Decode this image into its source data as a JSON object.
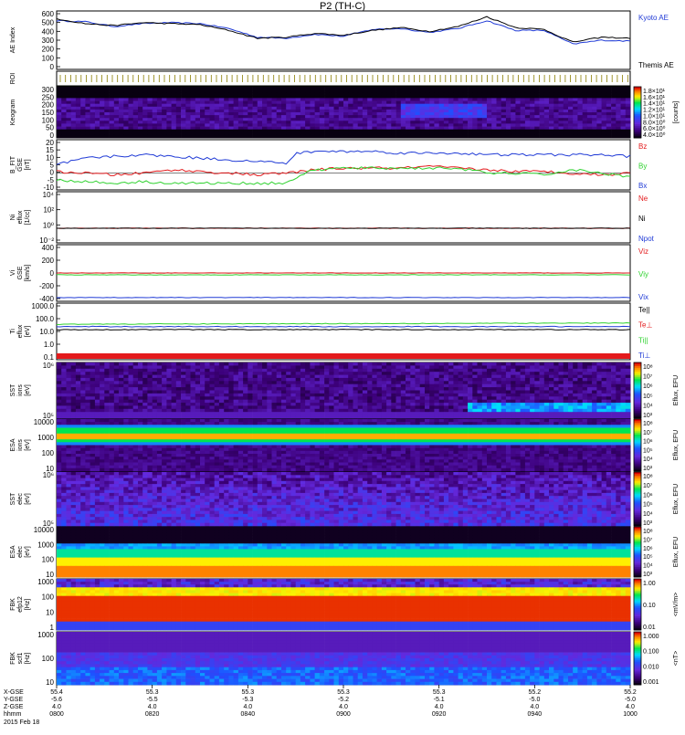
{
  "title": "P2 (TH-C)",
  "date_label": "2015 Feb 18",
  "colors": {
    "blue": "#1f3ad6",
    "red": "#e31a1c",
    "green": "#2fd22f",
    "black": "#000000"
  },
  "chart_data": [
    {
      "id": "ae",
      "type": "line",
      "ylabel": [
        "AE Index"
      ],
      "y_ticks": [
        "600",
        "500",
        "400",
        "300",
        "200",
        "100",
        "0"
      ],
      "ylim": [
        0,
        600
      ],
      "legend": [
        {
          "name": "Kyoto AE",
          "color": "#1f3ad6"
        },
        {
          "name": "Themis AE",
          "color": "#000000"
        }
      ],
      "series": [
        {
          "name": "Kyoto AE",
          "color": "#1f3ad6",
          "x": [
            0,
            0.05,
            0.1,
            0.15,
            0.2,
            0.25,
            0.3,
            0.35,
            0.4,
            0.45,
            0.5,
            0.55,
            0.6,
            0.65,
            0.7,
            0.75,
            0.8,
            0.85,
            0.9,
            0.95,
            1.0
          ],
          "values": [
            500,
            490,
            440,
            470,
            480,
            470,
            420,
            330,
            320,
            360,
            340,
            410,
            420,
            380,
            420,
            500,
            400,
            400,
            260,
            300,
            290
          ]
        },
        {
          "name": "Themis AE",
          "color": "#000000",
          "x": [
            0,
            0.05,
            0.1,
            0.15,
            0.2,
            0.25,
            0.3,
            0.35,
            0.4,
            0.45,
            0.5,
            0.55,
            0.6,
            0.65,
            0.7,
            0.75,
            0.8,
            0.85,
            0.9,
            0.95,
            1.0
          ],
          "values": [
            520,
            470,
            450,
            480,
            470,
            460,
            400,
            320,
            330,
            370,
            350,
            400,
            430,
            390,
            440,
            540,
            430,
            410,
            280,
            330,
            320
          ]
        }
      ]
    },
    {
      "id": "roi",
      "type": "table",
      "ylabel": [
        "ROI"
      ],
      "y_ticks": [],
      "legend": []
    },
    {
      "id": "keogram",
      "type": "heatmap",
      "ylabel": [
        "Keogram"
      ],
      "y_ticks": [
        "300",
        "250",
        "200",
        "150",
        "100",
        "50",
        "0"
      ],
      "ylim": [
        0,
        300
      ],
      "colorbar_ticks": [
        "1.8×10¹",
        "1.6×10¹",
        "1.4×10¹",
        "1.2×10¹",
        "1.0×10¹",
        "8.0×10⁰",
        "6.0×10⁰",
        "4.0×10⁰"
      ],
      "colorbar_label": "[counts]"
    },
    {
      "id": "bfield",
      "type": "line",
      "ylabel": [
        "B_FIT",
        "GSE",
        "[nT]"
      ],
      "y_ticks": [
        "20",
        "15",
        "10",
        "5",
        "0",
        "-5",
        "-10"
      ],
      "ylim": [
        -10,
        20
      ],
      "legend": [
        {
          "name": "Bz",
          "color": "#e31a1c"
        },
        {
          "name": "By",
          "color": "#2fd22f"
        },
        {
          "name": "Bx",
          "color": "#1f3ad6"
        }
      ],
      "series": [
        {
          "name": "Bx",
          "color": "#1f3ad6",
          "x": [
            0,
            0.05,
            0.1,
            0.15,
            0.2,
            0.25,
            0.3,
            0.35,
            0.4,
            0.42,
            0.45,
            0.5,
            0.55,
            0.6,
            0.65,
            0.7,
            0.75,
            0.8,
            0.85,
            0.9,
            0.95,
            1.0
          ],
          "values": [
            5,
            9,
            10,
            11,
            10,
            9,
            8,
            7,
            6,
            12,
            13,
            13,
            13,
            12,
            12,
            12,
            11,
            11,
            11,
            11,
            11,
            10
          ]
        },
        {
          "name": "Bz",
          "color": "#e31a1c",
          "x": [
            0,
            0.05,
            0.1,
            0.15,
            0.2,
            0.25,
            0.3,
            0.35,
            0.4,
            0.45,
            0.5,
            0.55,
            0.6,
            0.65,
            0.7,
            0.75,
            0.8,
            0.85,
            0.9,
            0.95,
            1.0
          ],
          "values": [
            1,
            0,
            -1,
            0,
            2,
            1,
            0,
            -1,
            0,
            2,
            3,
            3,
            3,
            4,
            3,
            2,
            1,
            1,
            0,
            -1,
            0
          ]
        },
        {
          "name": "By",
          "color": "#2fd22f",
          "x": [
            0,
            0.05,
            0.1,
            0.15,
            0.2,
            0.25,
            0.3,
            0.35,
            0.4,
            0.42,
            0.45,
            0.5,
            0.55,
            0.6,
            0.65,
            0.7,
            0.75,
            0.8,
            0.85,
            0.9,
            0.95,
            1.0
          ],
          "values": [
            -4,
            -5,
            -6,
            -5,
            -6,
            -6,
            -6,
            -6,
            -6,
            -2,
            2,
            3,
            3,
            3,
            3,
            3,
            0,
            0,
            -1,
            2,
            0,
            -2
          ]
        }
      ]
    },
    {
      "id": "density",
      "type": "line",
      "ylabel": [
        "Ni",
        "eflux",
        "[1/cc]"
      ],
      "y_ticks": [
        "10⁴",
        "10²",
        "10⁰",
        "10⁻²"
      ],
      "ylim": [
        -2,
        5
      ],
      "legend": [
        {
          "name": "Ne",
          "color": "#e31a1c"
        },
        {
          "name": "Ni",
          "color": "#000000"
        },
        {
          "name": "Npot",
          "color": "#1f3ad6"
        }
      ],
      "series": [
        {
          "name": "Ne",
          "color": "#e31a1c",
          "x": [
            0,
            1
          ],
          "values": [
            0,
            0
          ]
        },
        {
          "name": "Ni",
          "color": "#000000",
          "x": [
            0,
            1
          ],
          "values": [
            0,
            0
          ]
        }
      ]
    },
    {
      "id": "velocity",
      "type": "line",
      "ylabel": [
        "Vi",
        "GSE",
        "[km/s]"
      ],
      "y_ticks": [
        "400",
        "200",
        "0",
        "-200",
        "-400"
      ],
      "ylim": [
        -450,
        450
      ],
      "legend": [
        {
          "name": "Viz",
          "color": "#e31a1c"
        },
        {
          "name": "Viy",
          "color": "#2fd22f"
        },
        {
          "name": "Vix",
          "color": "#1f3ad6"
        }
      ],
      "series": [
        {
          "name": "Viz",
          "color": "#e31a1c",
          "x": [
            0,
            1
          ],
          "values": [
            0,
            0
          ]
        },
        {
          "name": "Viy",
          "color": "#2fd22f",
          "x": [
            0,
            1
          ],
          "values": [
            -30,
            -30
          ]
        },
        {
          "name": "Vix",
          "color": "#1f3ad6",
          "x": [
            0,
            1
          ],
          "values": [
            -390,
            -390
          ]
        }
      ]
    },
    {
      "id": "temperature",
      "type": "line",
      "ylabel": [
        "Ti",
        "eflux",
        "[eV]"
      ],
      "y_ticks": [
        "1000.0",
        "100.0",
        "10.0",
        "1.0",
        "0.1"
      ],
      "ylim": [
        -1.2,
        3.5
      ],
      "legend": [
        {
          "name": "Te||",
          "color": "#000000"
        },
        {
          "name": "Te⊥",
          "color": "#e31a1c"
        },
        {
          "name": "Ti||",
          "color": "#2fd22f"
        },
        {
          "name": "Ti⊥",
          "color": "#1f3ad6"
        }
      ],
      "series": [
        {
          "name": "Ti||",
          "color": "#2fd22f",
          "x": [
            0,
            0.5,
            1
          ],
          "values": [
            1.75,
            1.8,
            1.85
          ]
        },
        {
          "name": "Ti⊥",
          "color": "#1f3ad6",
          "x": [
            0,
            1
          ],
          "values": [
            1.55,
            1.55
          ]
        },
        {
          "name": "Te||",
          "color": "#000000",
          "x": [
            0,
            1
          ],
          "values": [
            1.3,
            1.3
          ]
        }
      ]
    },
    {
      "id": "sst_ion",
      "type": "heatmap",
      "ylabel": [
        "SST",
        "ions",
        "[eV]"
      ],
      "y_ticks": [
        "10⁶",
        "10⁵"
      ],
      "colorbar_ticks": [
        "10⁸",
        "10⁷",
        "10⁶",
        "10⁵",
        "10⁴",
        "10³"
      ],
      "colorbar_label": "Eflux, EFU"
    },
    {
      "id": "esa_ion",
      "type": "heatmap",
      "ylabel": [
        "ESA",
        "ions",
        "[eV]"
      ],
      "y_ticks": [
        "10000",
        "1000",
        "100",
        "10"
      ],
      "colorbar_ticks": [
        "10⁸",
        "10⁷",
        "10⁶",
        "10⁵",
        "10⁴",
        "10³"
      ],
      "colorbar_label": "Eflux, EFU"
    },
    {
      "id": "sst_elec",
      "type": "heatmap",
      "ylabel": [
        "SST",
        "elec",
        "[eV]"
      ],
      "y_ticks": [
        "10⁶",
        "10⁵"
      ],
      "colorbar_ticks": [
        "10⁸",
        "10⁷",
        "10⁶",
        "10⁵",
        "10⁴",
        "10³"
      ],
      "colorbar_label": "Eflux, EFU"
    },
    {
      "id": "esa_elec",
      "type": "heatmap",
      "ylabel": [
        "ESA",
        "elec",
        "[eV]"
      ],
      "y_ticks": [
        "10000",
        "1000",
        "100",
        "10"
      ],
      "colorbar_ticks": [
        "10⁸",
        "10⁷",
        "10⁶",
        "10⁵",
        "10⁴",
        "10³"
      ],
      "colorbar_label": "Eflux, EFU"
    },
    {
      "id": "fbk_e12",
      "type": "heatmap",
      "ylabel": [
        "FBK",
        "efp12",
        "[Hz]"
      ],
      "y_ticks": [
        "1000",
        "100",
        "10",
        "1"
      ],
      "colorbar_ticks": [
        "1.00",
        "0.10",
        "0.01"
      ],
      "colorbar_label": "<mV/m>"
    },
    {
      "id": "fbk_scm",
      "type": "heatmap",
      "ylabel": [
        "FBK",
        "scf1",
        "[Hz]"
      ],
      "y_ticks": [
        "1000",
        "100",
        "10"
      ],
      "colorbar_ticks": [
        "1.000",
        "0.100",
        "0.010",
        "0.001"
      ],
      "colorbar_label": "<nT>"
    }
  ],
  "xaxis": {
    "row_labels": [
      "X-GSE",
      "Y-GSE",
      "Z-GSE",
      "hhmm"
    ],
    "ticks": [
      {
        "vals": [
          "55.4",
          "-5.6",
          "4.0",
          "0800"
        ]
      },
      {
        "vals": [
          "55.3",
          "-5.5",
          "4.0",
          "0820"
        ]
      },
      {
        "vals": [
          "55.3",
          "-5.3",
          "4.0",
          "0840"
        ]
      },
      {
        "vals": [
          "55.3",
          "-5.2",
          "4.0",
          "0900"
        ]
      },
      {
        "vals": [
          "55.3",
          "-5.1",
          "4.0",
          "0920"
        ]
      },
      {
        "vals": [
          "55.2",
          "-5.0",
          "4.0",
          "0940"
        ]
      },
      {
        "vals": [
          "55.2",
          "-5.0",
          "4.0",
          "1000"
        ]
      }
    ]
  }
}
